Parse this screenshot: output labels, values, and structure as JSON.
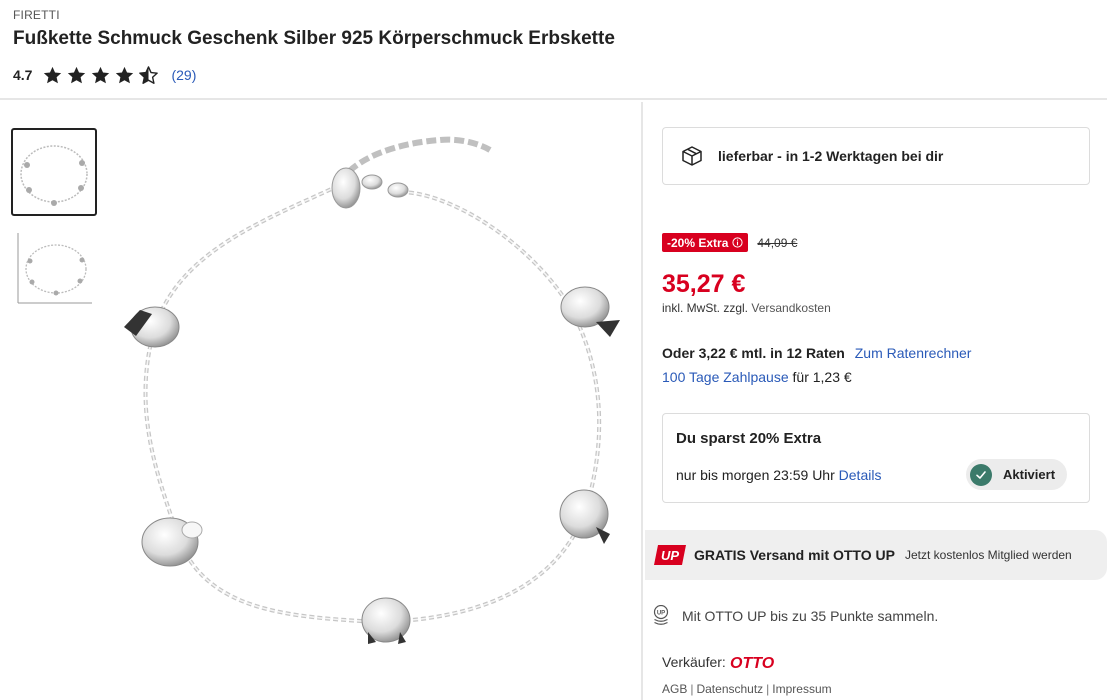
{
  "product": {
    "brand": "FIRETTI",
    "title": "Fußkette Schmuck Geschenk Silber 925 Körperschmuck Erbskette",
    "rating_value": "4.7",
    "rating_stars": 4.7,
    "rating_count": "(29)"
  },
  "gallery": {
    "thumbnails": [
      "bracelet-front",
      "bracelet-with-scale"
    ],
    "active_index": 0
  },
  "buybox": {
    "delivery": {
      "icon": "package-icon",
      "text": "lieferbar - in 1-2 Werktagen bei dir"
    },
    "discount_badge": "-20% Extra",
    "old_price": "44,09 €",
    "price": "35,27 €",
    "vat_prefix": "inkl. MwSt. zzgl.",
    "vat_link": "Versandkosten",
    "installment_text": "Oder 3,22 € mtl. in 12 Raten",
    "installment_link": "Zum Ratenrechner",
    "pause_link": "100 Tage Zahlpause",
    "pause_suffix": "für 1,23 €",
    "savings": {
      "title": "Du sparst 20% Extra",
      "until": "nur bis morgen 23:59 Uhr",
      "details_link": "Details",
      "status": "Aktiviert"
    },
    "up_banner": {
      "logo_text": "UP",
      "text": "GRATIS Versand mit OTTO UP",
      "join_link": "Jetzt kostenlos Mitglied werden"
    },
    "points_text": "Mit OTTO UP bis zu 35 Punkte sammeln.",
    "seller_label": "Verkäufer:",
    "seller_name": "OTTO",
    "legal_links": [
      "AGB",
      "Datenschutz",
      "Impressum"
    ]
  },
  "colors": {
    "accent_red": "#d8001f",
    "link_blue": "#2a5ab8",
    "check_green": "#3b7a6a"
  }
}
